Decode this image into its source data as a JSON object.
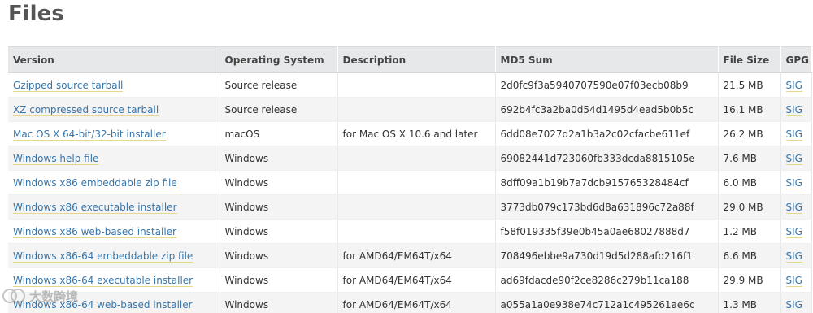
{
  "page": {
    "title": "Files"
  },
  "table": {
    "headers": [
      "Version",
      "Operating System",
      "Description",
      "MD5 Sum",
      "File Size",
      "GPG"
    ],
    "rows": [
      {
        "version": "Gzipped source tarball",
        "os": "Source release",
        "description": "",
        "md5": "2d0fc9f3a5940707590e07f03ecb08b9",
        "size": "21.5 MB",
        "gpg": "SIG"
      },
      {
        "version": "XZ compressed source tarball",
        "os": "Source release",
        "description": "",
        "md5": "692b4fc3a2ba0d54d1495d4ead5b0b5c",
        "size": "16.1 MB",
        "gpg": "SIG"
      },
      {
        "version": "Mac OS X 64-bit/32-bit installer",
        "os": "macOS",
        "description": "for Mac OS X 10.6 and later",
        "md5": "6dd08e7027d2a1b3a2c02cfacbe611ef",
        "size": "26.2 MB",
        "gpg": "SIG"
      },
      {
        "version": "Windows help file",
        "os": "Windows",
        "description": "",
        "md5": "69082441d723060fb333dcda8815105e",
        "size": "7.6 MB",
        "gpg": "SIG"
      },
      {
        "version": "Windows x86 embeddable zip file",
        "os": "Windows",
        "description": "",
        "md5": "8dff09a1b19b7a7dcb915765328484cf",
        "size": "6.0 MB",
        "gpg": "SIG"
      },
      {
        "version": "Windows x86 executable installer",
        "os": "Windows",
        "description": "",
        "md5": "3773db079c173bd6d8a631896c72a88f",
        "size": "29.0 MB",
        "gpg": "SIG"
      },
      {
        "version": "Windows x86 web-based installer",
        "os": "Windows",
        "description": "",
        "md5": "f58f019335f39e0b45a0ae68027888d7",
        "size": "1.2 MB",
        "gpg": "SIG"
      },
      {
        "version": "Windows x86-64 embeddable zip file",
        "os": "Windows",
        "description": "for AMD64/EM64T/x64",
        "md5": "708496ebbe9a730d19d5d288afd216f1",
        "size": "6.6 MB",
        "gpg": "SIG"
      },
      {
        "version": "Windows x86-64 executable installer",
        "os": "Windows",
        "description": "for AMD64/EM64T/x64",
        "md5": "ad69fdacde90f2ce8286c279b11ca188",
        "size": "29.9 MB",
        "gpg": "SIG"
      },
      {
        "version": "Windows x86-64 web-based installer",
        "os": "Windows",
        "description": "for AMD64/EM64T/x64",
        "md5": "a055a1a0e938e74c712a1c495261ae6c",
        "size": "1.3 MB",
        "gpg": "SIG"
      }
    ]
  },
  "watermark": {
    "text": "大数跨境",
    "icon": "kk-logo-icon"
  }
}
